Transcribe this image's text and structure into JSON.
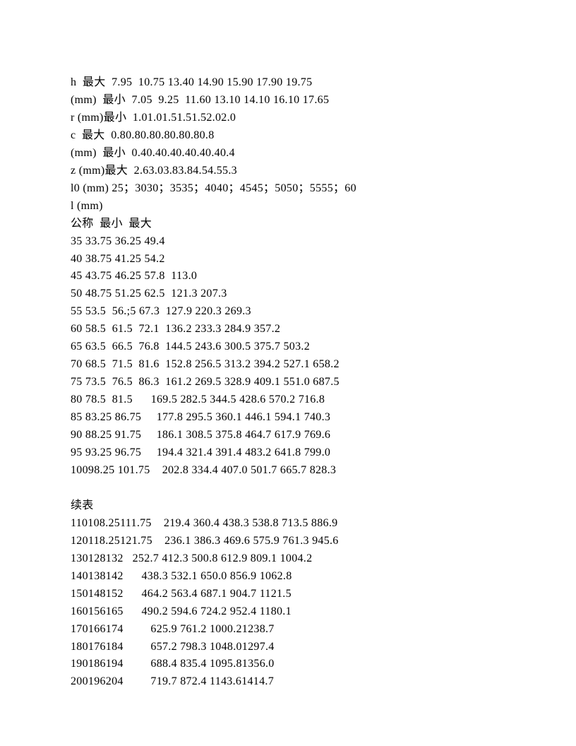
{
  "lines": [
    "h  最大  7.95  10.75 13.40 14.90 15.90 17.90 19.75",
    "(mm)  最小  7.05  9.25  11.60 13.10 14.10 16.10 17.65",
    "r (mm)最小  1.01.01.51.51.52.02.0",
    "c  最大  0.80.80.80.80.80.80.8",
    "(mm)  最小  0.40.40.40.40.40.40.4",
    "z (mm)最大  2.63.03.83.84.54.55.3",
    "l0 (mm) 25；3030；3535；4040；4545；5050；5555；60",
    "l (mm)",
    "公称  最小  最大",
    "35 33.75 36.25 49.4",
    "40 38.75 41.25 54.2",
    "45 43.75 46.25 57.8  113.0",
    "50 48.75 51.25 62.5  121.3 207.3",
    "55 53.5  56.;5 67.3  127.9 220.3 269.3",
    "60 58.5  61.5  72.1  136.2 233.3 284.9 357.2",
    "65 63.5  66.5  76.8  144.5 243.6 300.5 375.7 503.2",
    "70 68.5  71.5  81.6  152.8 256.5 313.2 394.2 527.1 658.2",
    "75 73.5  76.5  86.3  161.2 269.5 328.9 409.1 551.0 687.5",
    "80 78.5  81.5      169.5 282.5 344.5 428.6 570.2 716.8",
    "85 83.25 86.75     177.8 295.5 360.1 446.1 594.1 740.3",
    "90 88.25 91.75     186.1 308.5 375.8 464.7 617.9 769.6",
    "95 93.25 96.75     194.4 321.4 391.4 483.2 641.8 799.0",
    "10098.25 101.75    202.8 334.4 407.0 501.7 665.7 828.3",
    "",
    "续表",
    "110108.25111.75    219.4 360.4 438.3 538.8 713.5 886.9",
    "120118.25121.75    236.1 386.3 469.6 575.9 761.3 945.6",
    "130128132   252.7 412.3 500.8 612.9 809.1 1004.2",
    "140138142      438.3 532.1 650.0 856.9 1062.8",
    "150148152      464.2 563.4 687.1 904.7 1121.5",
    "160156165      490.2 594.6 724.2 952.4 1180.1",
    "170166174         625.9 761.2 1000.21238.7",
    "180176184         657.2 798.3 1048.01297.4",
    "190186194         688.4 835.4 1095.81356.0",
    "200196204         719.7 872.4 1143.61414.7"
  ]
}
